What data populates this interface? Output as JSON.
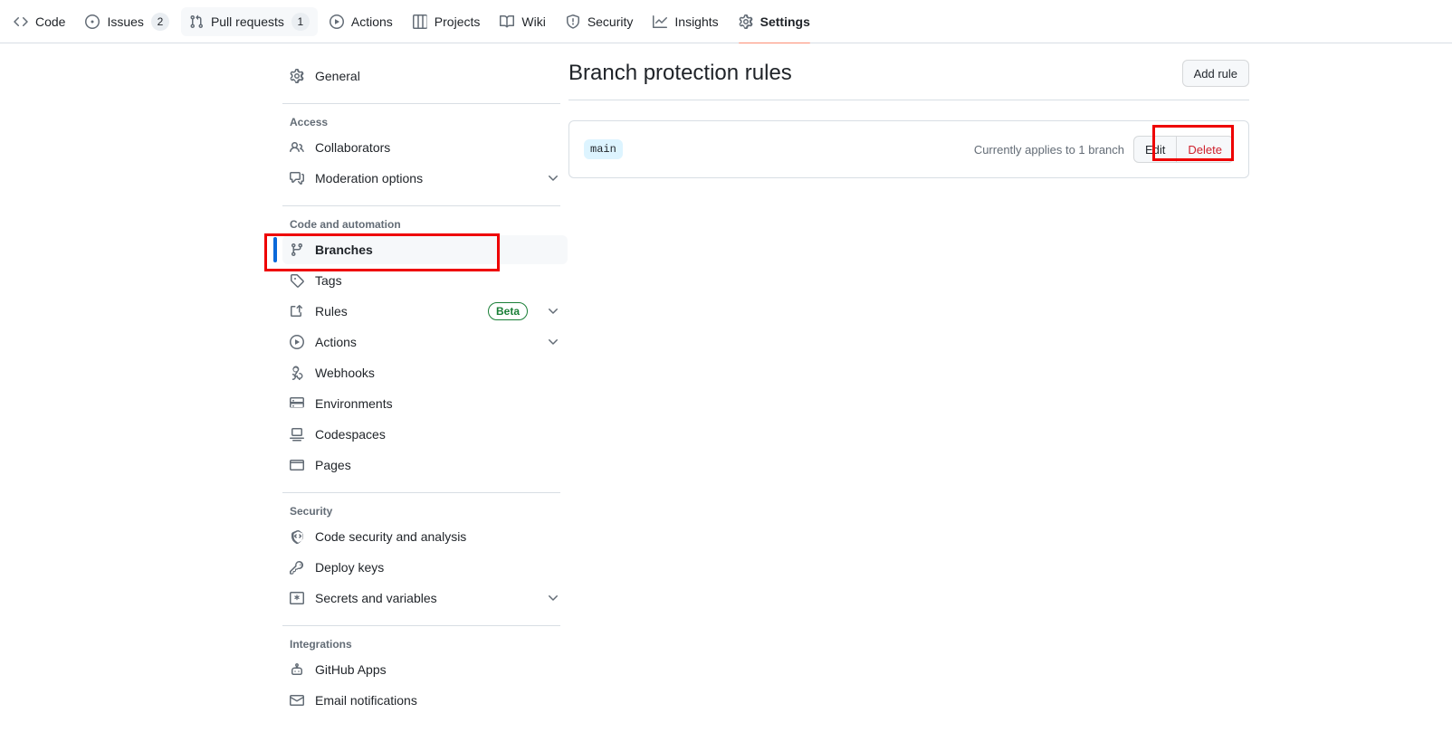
{
  "repo_nav": {
    "tabs": [
      {
        "label": "Code",
        "icon": "code-icon",
        "count": null,
        "state": "normal"
      },
      {
        "label": "Issues",
        "icon": "issue-icon",
        "count": "2",
        "state": "normal"
      },
      {
        "label": "Pull requests",
        "icon": "pull-request-icon",
        "count": "1",
        "state": "hovered"
      },
      {
        "label": "Actions",
        "icon": "play-icon",
        "count": null,
        "state": "normal"
      },
      {
        "label": "Projects",
        "icon": "table-icon",
        "count": null,
        "state": "normal"
      },
      {
        "label": "Wiki",
        "icon": "book-icon",
        "count": null,
        "state": "normal"
      },
      {
        "label": "Security",
        "icon": "shield-icon",
        "count": null,
        "state": "normal"
      },
      {
        "label": "Insights",
        "icon": "graph-icon",
        "count": null,
        "state": "normal"
      },
      {
        "label": "Settings",
        "icon": "gear-icon",
        "count": null,
        "state": "selected"
      }
    ]
  },
  "sidebar": {
    "general": {
      "label": "General",
      "icon": "gear-icon"
    },
    "groups": [
      {
        "title": "Access",
        "items": [
          {
            "label": "Collaborators",
            "icon": "people-icon",
            "chevron": false,
            "badge": null
          },
          {
            "label": "Moderation options",
            "icon": "comment-icon",
            "chevron": true,
            "badge": null
          }
        ]
      },
      {
        "title": "Code and automation",
        "items": [
          {
            "label": "Branches",
            "icon": "branch-icon",
            "chevron": false,
            "badge": null,
            "active": true
          },
          {
            "label": "Tags",
            "icon": "tag-icon",
            "chevron": false,
            "badge": null
          },
          {
            "label": "Rules",
            "icon": "rules-icon",
            "chevron": true,
            "badge": "Beta"
          },
          {
            "label": "Actions",
            "icon": "play-icon",
            "chevron": true,
            "badge": null
          },
          {
            "label": "Webhooks",
            "icon": "webhook-icon",
            "chevron": false,
            "badge": null
          },
          {
            "label": "Environments",
            "icon": "server-icon",
            "chevron": false,
            "badge": null
          },
          {
            "label": "Codespaces",
            "icon": "codespaces-icon",
            "chevron": false,
            "badge": null
          },
          {
            "label": "Pages",
            "icon": "browser-icon",
            "chevron": false,
            "badge": null
          }
        ]
      },
      {
        "title": "Security",
        "items": [
          {
            "label": "Code security and analysis",
            "icon": "code-scan-icon",
            "chevron": false,
            "badge": null
          },
          {
            "label": "Deploy keys",
            "icon": "key-icon",
            "chevron": false,
            "badge": null
          },
          {
            "label": "Secrets and variables",
            "icon": "asterisk-icon",
            "chevron": true,
            "badge": null
          }
        ]
      },
      {
        "title": "Integrations",
        "items": [
          {
            "label": "GitHub Apps",
            "icon": "apps-icon",
            "chevron": false,
            "badge": null
          },
          {
            "label": "Email notifications",
            "icon": "mail-icon",
            "chevron": false,
            "badge": null
          }
        ]
      }
    ]
  },
  "main": {
    "title": "Branch protection rules",
    "add_rule_label": "Add rule",
    "rule": {
      "branch_pattern": "main",
      "applies_text": "Currently applies to 1 branch",
      "edit_label": "Edit",
      "delete_label": "Delete"
    }
  },
  "colors": {
    "accent_blue": "#0969da",
    "selected_underline": "#fd8c73",
    "annotation_red": "#ee0000",
    "beta_green": "#1a7f37",
    "delete_red": "#cf222e",
    "branch_chip_bg": "#ddf4ff"
  }
}
